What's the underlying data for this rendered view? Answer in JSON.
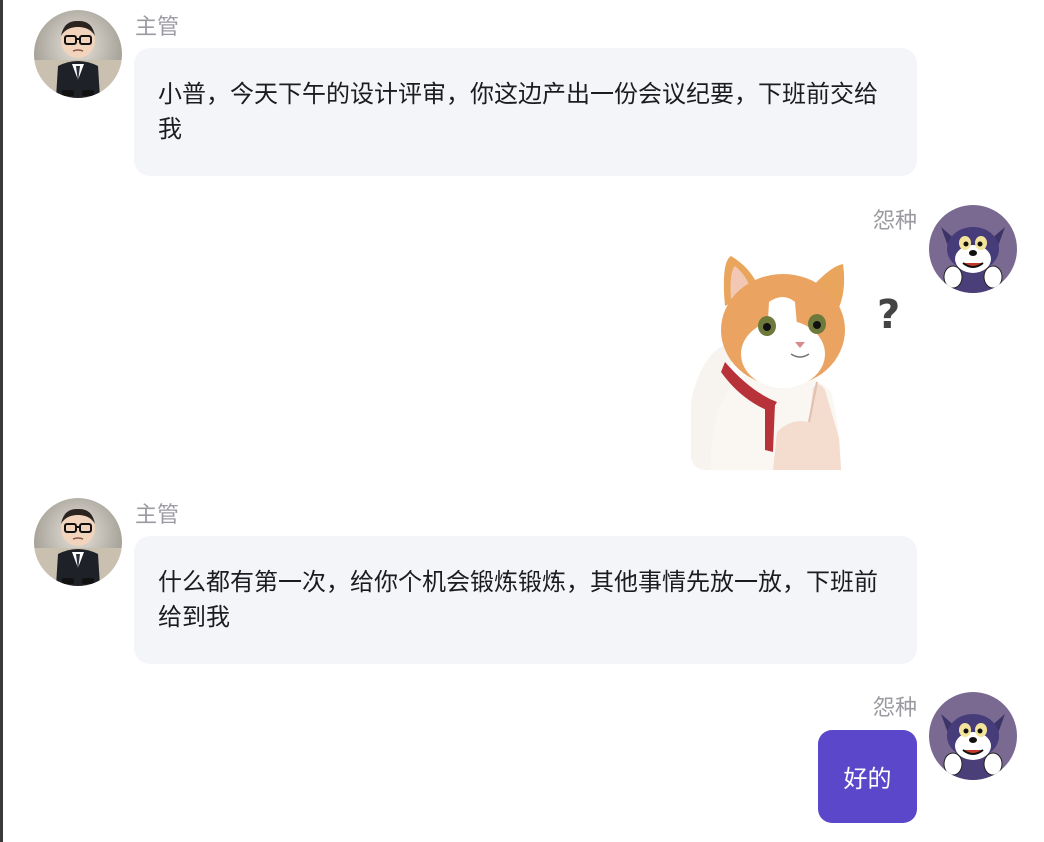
{
  "chat": {
    "messages": [
      {
        "sender": "主管",
        "side": "incoming",
        "avatar_icon": "boss-avatar-icon",
        "type": "text",
        "text": "小普，今天下午的设计评审，你这边产出一份会议纪要，下班前交给我"
      },
      {
        "sender": "怨种",
        "side": "outgoing",
        "avatar_icon": "cartoon-cat-avatar-icon",
        "type": "sticker",
        "sticker_icon": "confused-cat-sticker-icon",
        "sticker_text": "?"
      },
      {
        "sender": "主管",
        "side": "incoming",
        "avatar_icon": "boss-avatar-icon",
        "type": "text",
        "text": "什么都有第一次，给你个机会锻炼锻炼，其他事情先放一放，下班前给到我"
      },
      {
        "sender": "怨种",
        "side": "outgoing",
        "avatar_icon": "cartoon-cat-avatar-icon",
        "type": "text",
        "text": "好的"
      }
    ]
  },
  "colors": {
    "incoming_bubble": "#f4f5f9",
    "outgoing_bubble": "#5b47c9",
    "sender_name": "#9a9aa0",
    "message_text": "#1c1c1e"
  }
}
